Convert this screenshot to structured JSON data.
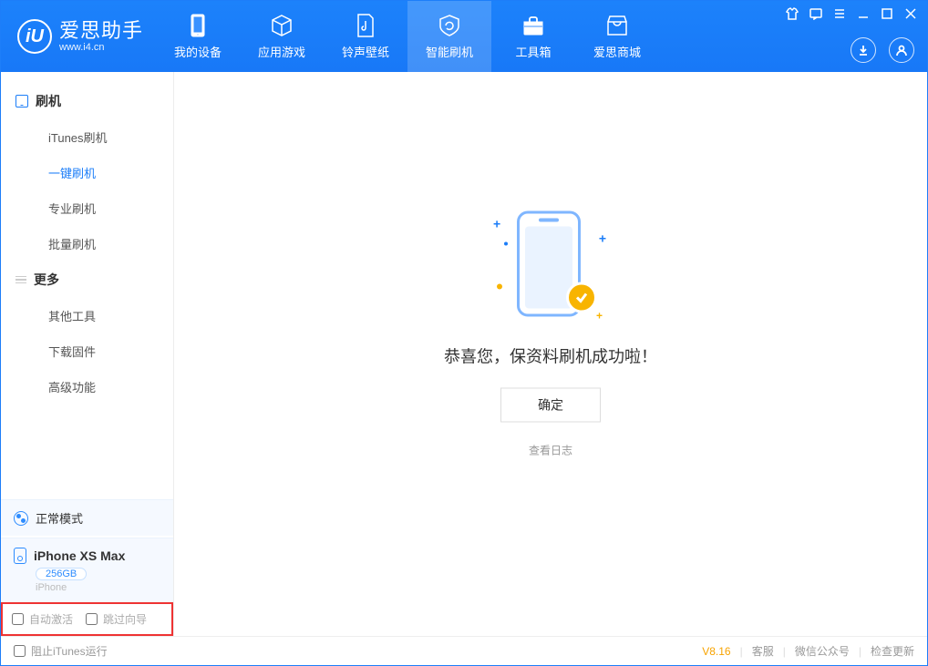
{
  "brand": {
    "title": "爱思助手",
    "subtitle": "www.i4.cn",
    "logo_letter": "iU"
  },
  "nav": {
    "items": [
      {
        "label": "我的设备"
      },
      {
        "label": "应用游戏"
      },
      {
        "label": "铃声壁纸"
      },
      {
        "label": "智能刷机"
      },
      {
        "label": "工具箱"
      },
      {
        "label": "爱思商城"
      }
    ]
  },
  "sidebar": {
    "section1": {
      "title": "刷机",
      "items": [
        "iTunes刷机",
        "一键刷机",
        "专业刷机",
        "批量刷机"
      ]
    },
    "section2": {
      "title": "更多",
      "items": [
        "其他工具",
        "下载固件",
        "高级功能"
      ]
    },
    "mode_label": "正常模式",
    "device": {
      "name": "iPhone XS Max",
      "capacity": "256GB",
      "type": "iPhone"
    },
    "options": {
      "auto_activate": "自动激活",
      "skip_guide": "跳过向导"
    }
  },
  "content": {
    "message": "恭喜您，保资料刷机成功啦！",
    "ok_button": "确定",
    "log_link": "查看日志"
  },
  "footer": {
    "block_itunes": "阻止iTunes运行",
    "version": "V8.16",
    "links": [
      "客服",
      "微信公众号",
      "检查更新"
    ]
  }
}
